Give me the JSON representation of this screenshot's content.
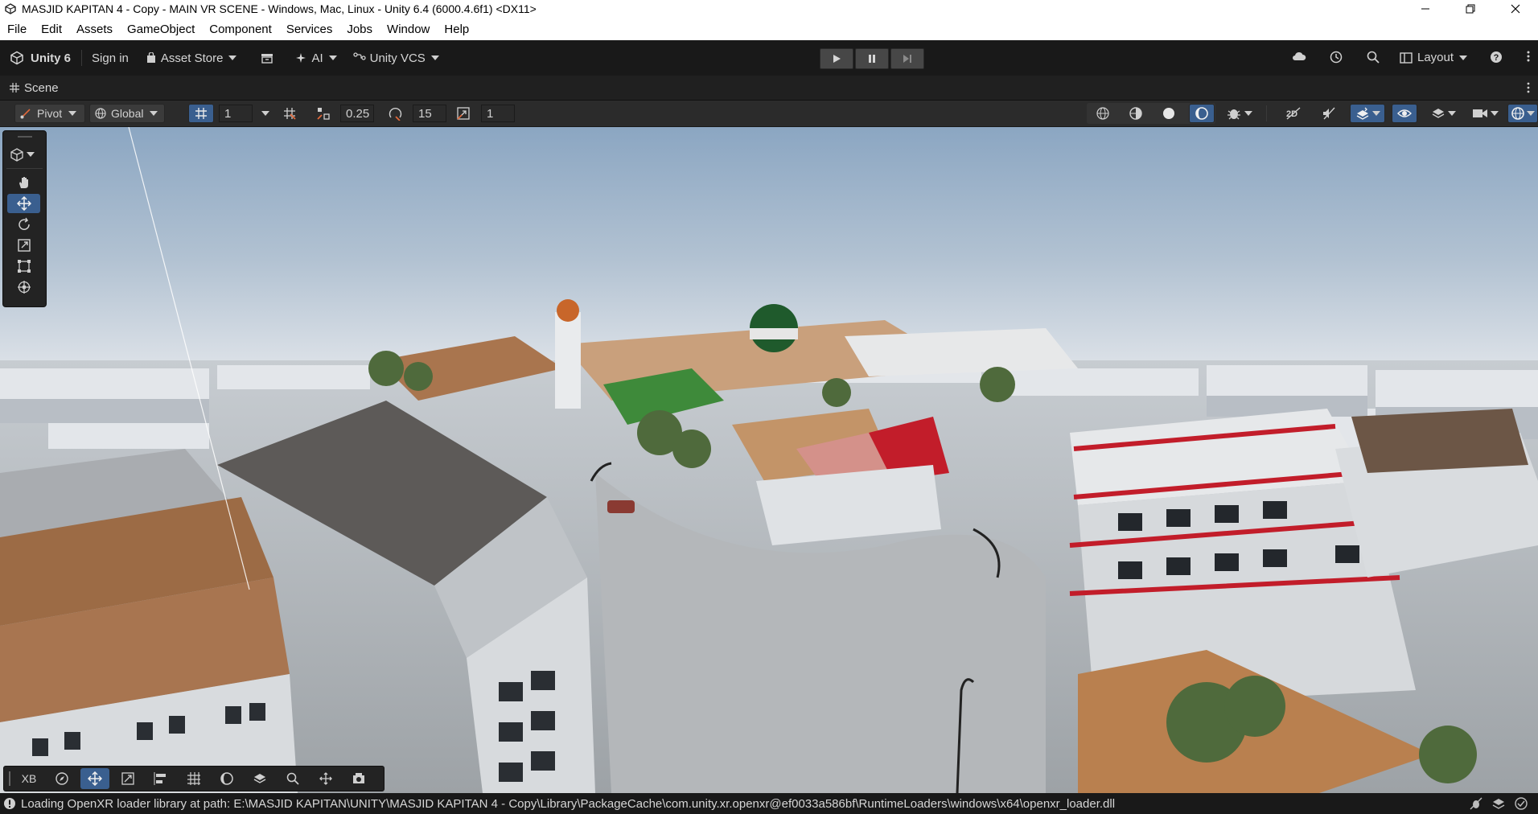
{
  "window": {
    "title": "MASJID KAPITAN 4 - Copy - MAIN VR SCENE - Windows, Mac, Linux - Unity 6.4 (6000.4.6f1) <DX11>"
  },
  "menu": [
    "File",
    "Edit",
    "Assets",
    "GameObject",
    "Component",
    "Services",
    "Jobs",
    "Window",
    "Help"
  ],
  "toolbar": {
    "brand": "Unity 6",
    "sign_in": "Sign in",
    "asset_store": "Asset Store",
    "ai": "AI",
    "vcs": "Unity VCS",
    "layout": "Layout"
  },
  "scene": {
    "tab_label": "Scene",
    "pivot": "Pivot",
    "global": "Global",
    "grid_size": "1",
    "snap_increment": "0.25",
    "rotate_snap": "15",
    "scale_snap": "1"
  },
  "overlay": {
    "xb_label": "XB"
  },
  "status": {
    "message": "Loading OpenXR loader library at path: E:\\MASJID KAPITAN\\UNITY\\MASJID KAPITAN 4 - Copy\\Library\\PackageCache\\com.unity.xr.openxr@ef0033a586bf\\RuntimeLoaders\\windows\\x64\\openxr_loader.dll"
  },
  "colors": {
    "accent_active": "#3a5f8f",
    "sky_top": "#8fa9c4",
    "sky_horizon": "#dfe3e7",
    "roof_brown": "#9c6b45",
    "dome_green": "#1f5a2c",
    "roof_red": "#c21d2a"
  },
  "icons": {
    "app": "unity-logo-icon",
    "play": "play-icon",
    "pause": "pause-icon",
    "step": "step-icon",
    "cloud": "cloud-icon",
    "history": "history-icon",
    "search": "search-icon",
    "help": "help-icon"
  }
}
